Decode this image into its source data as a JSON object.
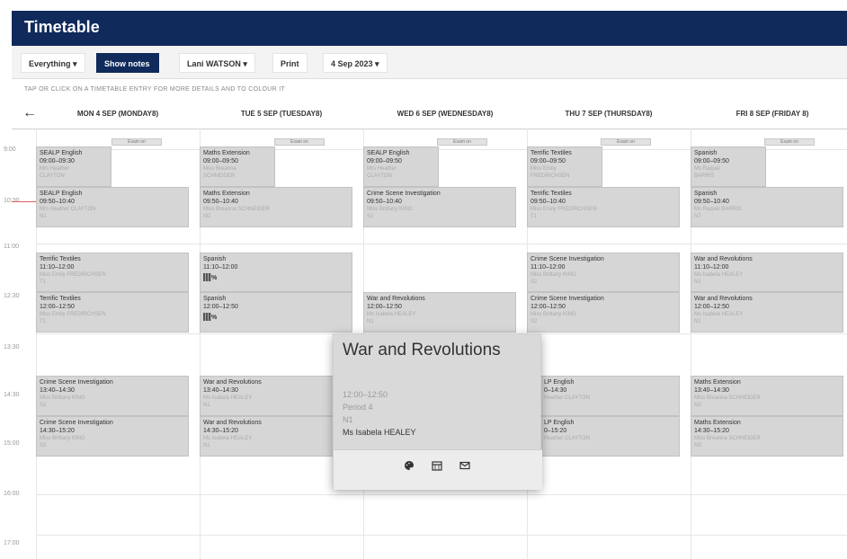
{
  "app": {
    "title": "Timetable"
  },
  "toolbar": {
    "filter": "Everything ▾",
    "show_notes": "Show notes",
    "student": "Lani WATSON ▾",
    "print": "Print",
    "date": "4 Sep 2023 ▾"
  },
  "hint": "TAP OR CLICK ON A TIMETABLE ENTRY FOR MORE DETAILS AND TO COLOUR IT",
  "nav": {
    "back_icon": "arrow-left-icon"
  },
  "days": [
    "MON 4 SEP (MONDAY8)",
    "TUE 5 SEP (TUESDAY8)",
    "WED 6 SEP (WEDNESDAY8)",
    "THU 7 SEP (THURSDAY8)",
    "FRI 8 SEP (FRIDAY 8)"
  ],
  "times": [
    "9:00",
    "10:30",
    "11:00",
    "12:30",
    "13:30",
    "14:30",
    "15:00",
    "16:00",
    "17:00"
  ],
  "exam_label": "Exam on",
  "lessons": {
    "mon_p1": {
      "subject": "SEALP English",
      "time": "09:00–09:30",
      "teacher": "Mrs Heather",
      "room": "CLAYTON"
    },
    "mon_p2": {
      "subject": "SEALP English",
      "time": "09:50–10:40",
      "teacher": "Mrs Heather CLAYTON",
      "room": "N1"
    },
    "mon_p3": {
      "subject": "Terrific Textiles",
      "time": "11:10–12:00",
      "teacher": "Miss Emily FREDRICHSEN",
      "room": "T1"
    },
    "mon_p4": {
      "subject": "Terrific Textiles",
      "time": "12:00–12:50",
      "teacher": "Miss Emily FREDRICHSEN",
      "room": "T1"
    },
    "mon_p5": {
      "subject": "Crime Scene Investigation",
      "time": "13:40–14:30",
      "teacher": "Miss Brittany KING",
      "room": "S2"
    },
    "mon_p6": {
      "subject": "Crime Scene Investigation",
      "time": "14:30–15:20",
      "teacher": "Miss Brittany KING",
      "room": "S2"
    },
    "tue_p1": {
      "subject": "Maths Extension",
      "time": "09:00–09:50",
      "teacher": "Miss Breanna",
      "room": "SCHNEIDER"
    },
    "tue_p2": {
      "subject": "Maths Extension",
      "time": "09:50–10:40",
      "teacher": "Miss Breanna SCHNEIDER",
      "room": "M2"
    },
    "tue_p3": {
      "subject": "Spanish",
      "time": "11:10–12:00",
      "teacher": "",
      "room": ""
    },
    "tue_p4": {
      "subject": "Spanish",
      "time": "12:00–12:50",
      "teacher": "",
      "room": ""
    },
    "tue_p5": {
      "subject": "War and Revolutions",
      "time": "13:40–14:30",
      "teacher": "Ms Isabela HEALEY",
      "room": "N1"
    },
    "tue_p6": {
      "subject": "War and Revolutions",
      "time": "14:30–15:20",
      "teacher": "Ms Isabela HEALEY",
      "room": "N1"
    },
    "wed_p1": {
      "subject": "SEALP English",
      "time": "09:00–09:50",
      "teacher": "Mrs Heather",
      "room": "CLAYTON"
    },
    "wed_p2": {
      "subject": "Crime Scene Investigation",
      "time": "09:50–10:40",
      "teacher": "Miss Brittany KING",
      "room": "S2"
    },
    "wed_p4": {
      "subject": "War and Revolutions",
      "time": "12:00–12:50",
      "teacher": "Ms Isabela HEALEY",
      "room": "N1"
    },
    "thu_p1": {
      "subject": "Terrific Textiles",
      "time": "09:00–09:50",
      "teacher": "Miss Emily",
      "room": "FREDRICHSEN"
    },
    "thu_p2": {
      "subject": "Terrific Textiles",
      "time": "09:50–10:40",
      "teacher": "Miss Emily FREDRICHSEN",
      "room": "T1"
    },
    "thu_p3": {
      "subject": "Crime Scene Investigation",
      "time": "11:10–12:00",
      "teacher": "Miss Brittany KING",
      "room": "S2"
    },
    "thu_p4": {
      "subject": "Crime Scene Investigation",
      "time": "12:00–12:50",
      "teacher": "Miss Brittany KING",
      "room": "S2"
    },
    "thu_p5": {
      "subject": "LP English",
      "time": "0–14:30",
      "teacher": "Heather CLAYTON",
      "room": ""
    },
    "thu_p6": {
      "subject": "LP English",
      "time": "0–15:20",
      "teacher": "Heather CLAYTON",
      "room": ""
    },
    "fri_p1": {
      "subject": "Spanish",
      "time": "09:00–09:50",
      "teacher": "Ms Raquel",
      "room": "BARRIS"
    },
    "fri_p2": {
      "subject": "Spanish",
      "time": "09:50–10:40",
      "teacher": "Ms Raquel BARRIS",
      "room": "N7"
    },
    "fri_p3": {
      "subject": "War and Revolutions",
      "time": "11:10–12:00",
      "teacher": "Ms Isabela HEALEY",
      "room": "N1"
    },
    "fri_p4": {
      "subject": "War and Revolutions",
      "time": "12:00–12:50",
      "teacher": "Ms Isabela HEALEY",
      "room": "N1"
    },
    "fri_p5": {
      "subject": "Maths Extension",
      "time": "13:40–14:30",
      "teacher": "Miss Breanna SCHNEIDER",
      "room": "M2"
    },
    "fri_p6": {
      "subject": "Maths Extension",
      "time": "14:30–15:20",
      "teacher": "Miss Breanna SCHNEIDER",
      "room": "M2"
    }
  },
  "popup": {
    "title": "War and Revolutions",
    "time": "12:00–12:50",
    "period": "Period 4",
    "room": "N1",
    "teacher": "Ms Isabela HEALEY",
    "actions": [
      "palette-icon",
      "calendar-icon",
      "email-icon"
    ]
  },
  "colors": {
    "brand": "#0f2a5b",
    "lesson_bg": "#d6d6d6",
    "now_line": "#e06060"
  }
}
